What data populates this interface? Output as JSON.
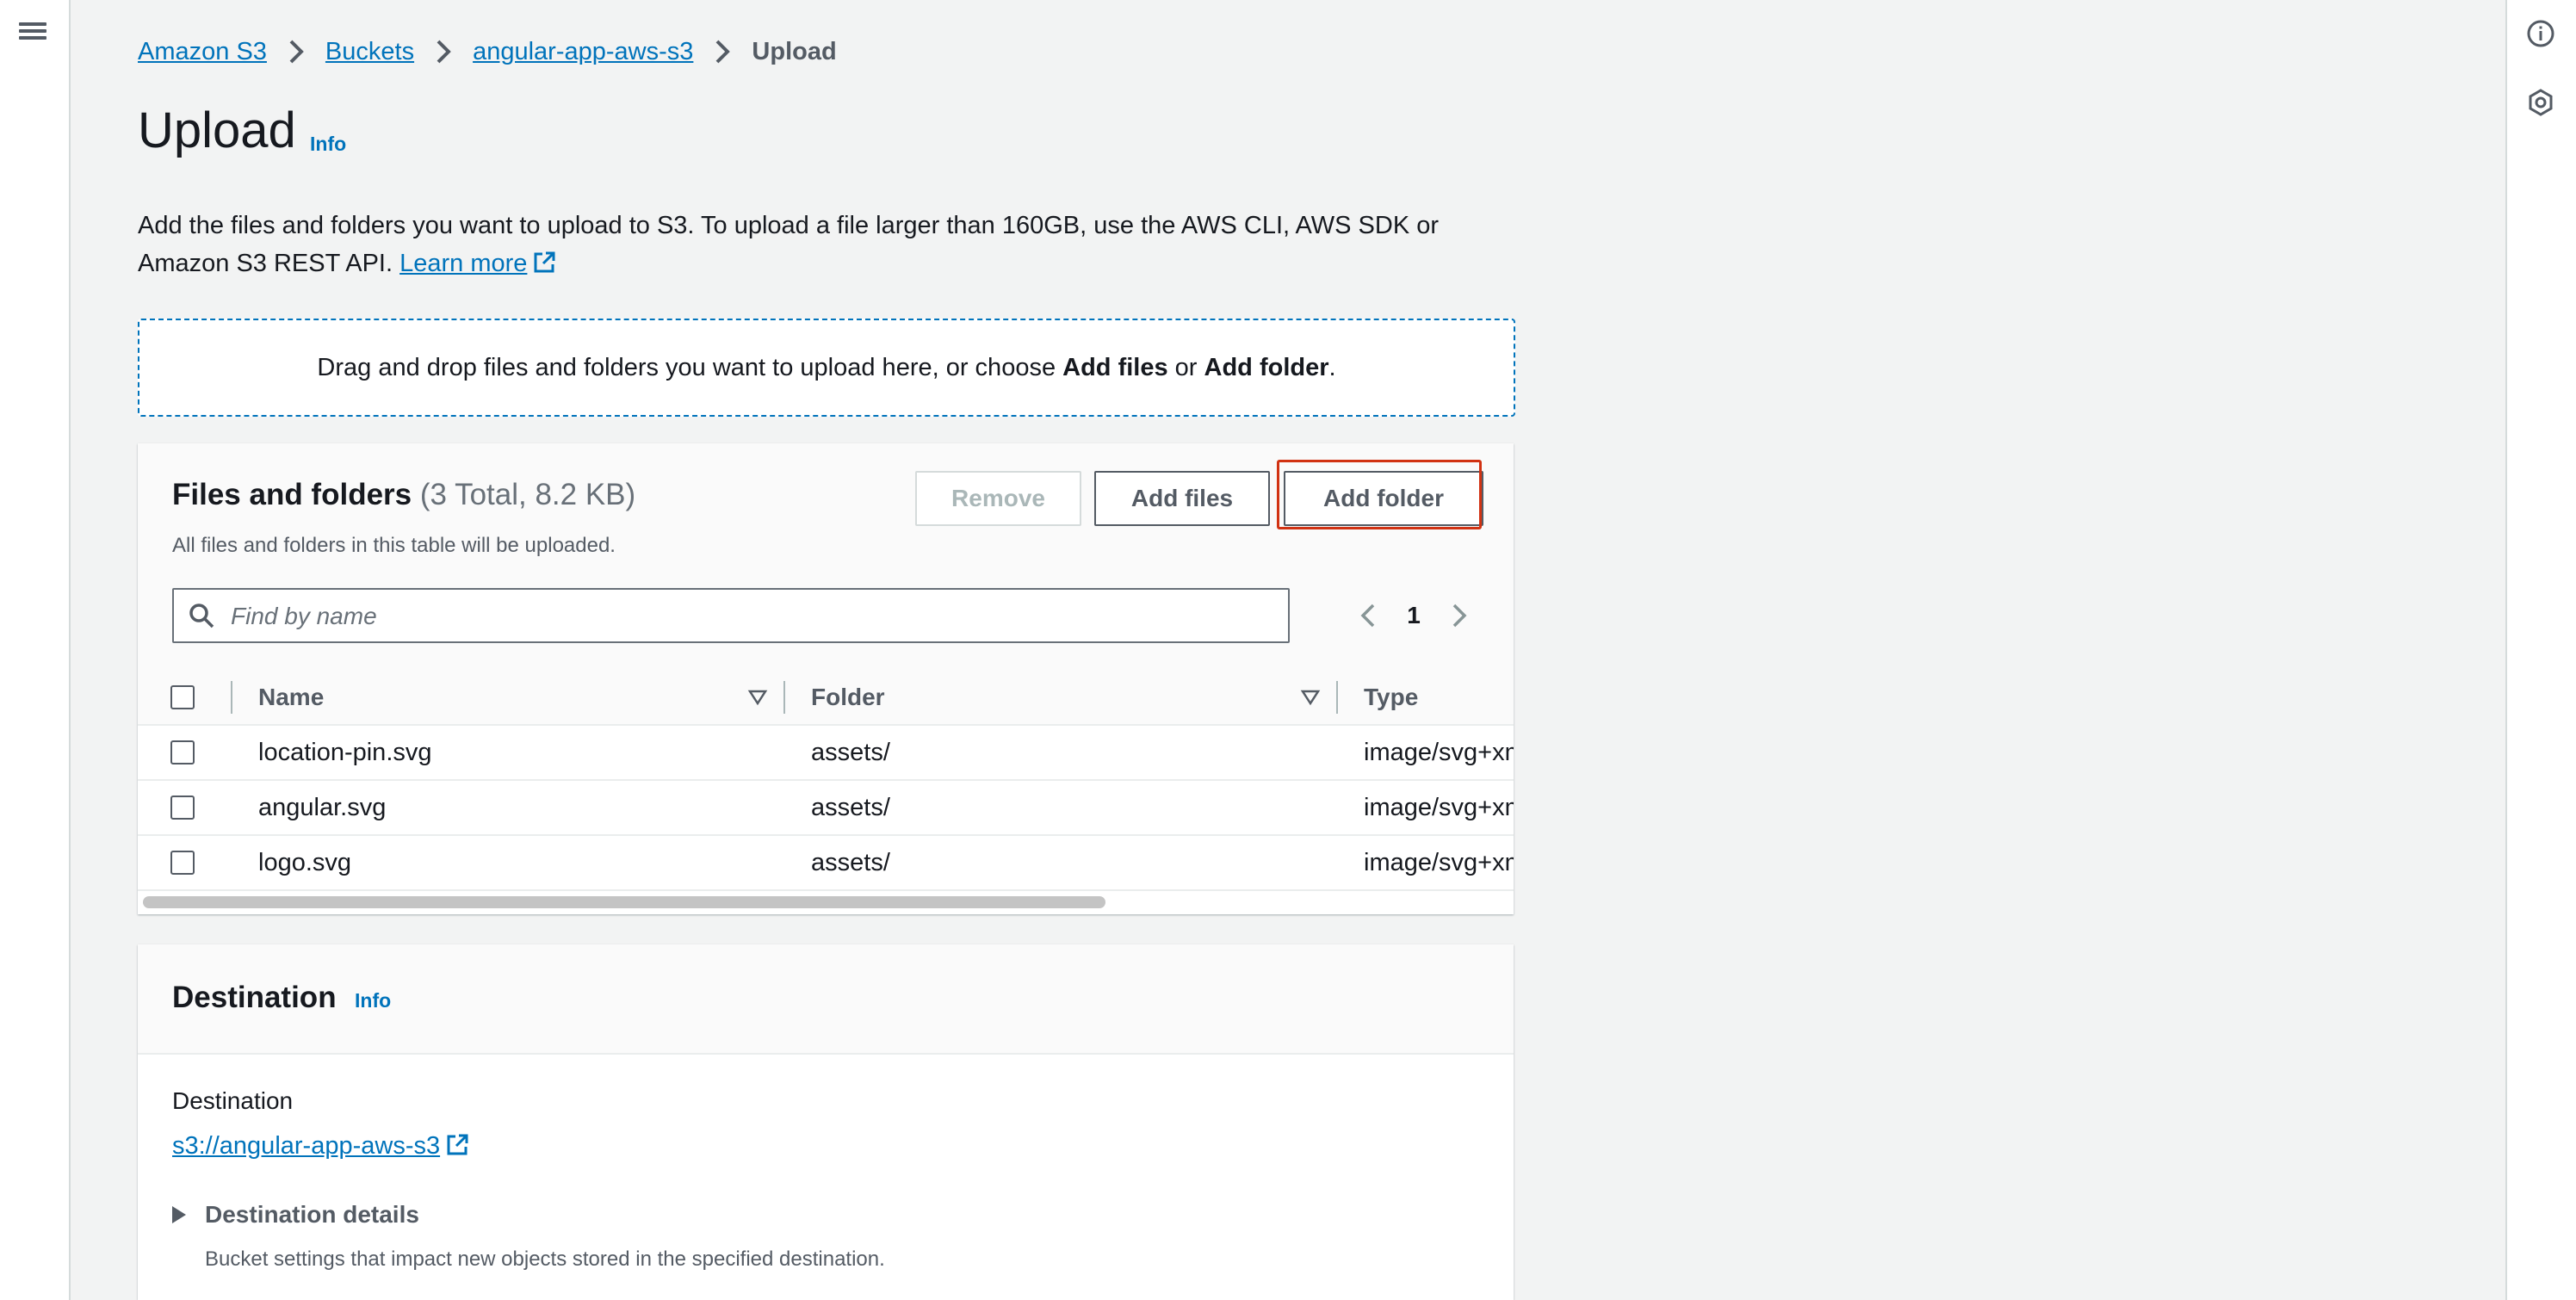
{
  "breadcrumb": {
    "items": [
      "Amazon S3",
      "Buckets",
      "angular-app-aws-s3"
    ],
    "current": "Upload"
  },
  "page": {
    "title": "Upload",
    "info": "Info",
    "intro_text": "Add the files and folders you want to upload to S3. To upload a file larger than 160GB, use the AWS CLI, AWS SDK or Amazon S3 REST API.",
    "learn_more": "Learn more"
  },
  "dropzone": {
    "text_before": "Drag and drop files and folders you want to upload here, or choose ",
    "add_files": "Add files",
    "or": " or ",
    "add_folder": "Add folder",
    "period": "."
  },
  "files_panel": {
    "title": "Files and folders",
    "count": "(3 Total, 8.2 KB)",
    "description": "All files and folders in this table will be uploaded.",
    "buttons": {
      "remove": "Remove",
      "add_files": "Add files",
      "add_folder": "Add folder"
    },
    "search_placeholder": "Find by name",
    "page": "1",
    "columns": {
      "name": "Name",
      "folder": "Folder",
      "type": "Type"
    },
    "rows": [
      {
        "name": "location-pin.svg",
        "folder": "assets/",
        "type": "image/svg+xml"
      },
      {
        "name": "angular.svg",
        "folder": "assets/",
        "type": "image/svg+xml"
      },
      {
        "name": "logo.svg",
        "folder": "assets/",
        "type": "image/svg+xml"
      }
    ]
  },
  "destination_panel": {
    "title": "Destination",
    "info": "Info",
    "label": "Destination",
    "link": "s3://angular-app-aws-s3",
    "details_title": "Destination details",
    "details_desc": "Bucket settings that impact new objects stored in the specified destination."
  },
  "colors": {
    "link": "#0073bb",
    "highlight": "#d13212",
    "text": "#16191f",
    "muted": "#545b64"
  },
  "icons": [
    "menu-icon",
    "info-circle-icon",
    "settings-icon",
    "chevron-right-icon",
    "external-link-icon",
    "search-icon",
    "chevron-left-icon",
    "sort-icon",
    "caret-right-icon"
  ]
}
